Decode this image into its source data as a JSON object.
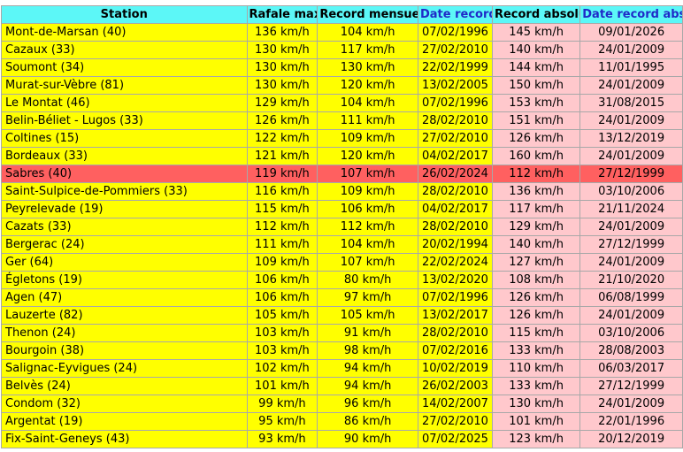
{
  "headers": {
    "station": "Station",
    "rafale_max": "Rafale max",
    "record_mensuel": "Record mensuel",
    "date_record": "Date record",
    "record_absolu": "Record absolu",
    "date_record_abs": "Date record abs."
  },
  "colors": {
    "header_bg": "#5cf7f7",
    "row_bg": "#ffff00",
    "absolute_bg": "#ffc8cc",
    "highlight_bg": "#ff6060",
    "header_date_text": "#1f29c8"
  },
  "highlighted_station": "Sabres (40)",
  "rows": [
    {
      "station": "Mont-de-Marsan (40)",
      "rafale": "136 km/h",
      "mensuel": "104 km/h",
      "date": "07/02/1996",
      "absolu": "145 km/h",
      "date_abs": "09/01/2026"
    },
    {
      "station": "Cazaux (33)",
      "rafale": "130 km/h",
      "mensuel": "117 km/h",
      "date": "27/02/2010",
      "absolu": "140 km/h",
      "date_abs": "24/01/2009"
    },
    {
      "station": "Soumont (34)",
      "rafale": "130 km/h",
      "mensuel": "130 km/h",
      "date": "22/02/1999",
      "absolu": "144 km/h",
      "date_abs": "11/01/1995"
    },
    {
      "station": "Murat-sur-Vèbre (81)",
      "rafale": "130 km/h",
      "mensuel": "120 km/h",
      "date": "13/02/2005",
      "absolu": "150 km/h",
      "date_abs": "24/01/2009"
    },
    {
      "station": "Le Montat (46)",
      "rafale": "129 km/h",
      "mensuel": "104 km/h",
      "date": "07/02/1996",
      "absolu": "153 km/h",
      "date_abs": "31/08/2015"
    },
    {
      "station": "Belin-Béliet - Lugos (33)",
      "rafale": "126 km/h",
      "mensuel": "111 km/h",
      "date": "28/02/2010",
      "absolu": "151 km/h",
      "date_abs": "24/01/2009"
    },
    {
      "station": "Coltines (15)",
      "rafale": "122 km/h",
      "mensuel": "109 km/h",
      "date": "27/02/2010",
      "absolu": "126 km/h",
      "date_abs": "13/12/2019"
    },
    {
      "station": "Bordeaux (33)",
      "rafale": "121 km/h",
      "mensuel": "120 km/h",
      "date": "04/02/2017",
      "absolu": "160 km/h",
      "date_abs": "24/01/2009"
    },
    {
      "station": "Sabres (40)",
      "rafale": "119 km/h",
      "mensuel": "107 km/h",
      "date": "26/02/2024",
      "absolu": "112 km/h",
      "date_abs": "27/12/1999"
    },
    {
      "station": "Saint-Sulpice-de-Pommiers (33)",
      "rafale": "116 km/h",
      "mensuel": "109 km/h",
      "date": "28/02/2010",
      "absolu": "136 km/h",
      "date_abs": "03/10/2006"
    },
    {
      "station": "Peyrelevade (19)",
      "rafale": "115 km/h",
      "mensuel": "106 km/h",
      "date": "04/02/2017",
      "absolu": "117 km/h",
      "date_abs": "21/11/2024"
    },
    {
      "station": "Cazats (33)",
      "rafale": "112 km/h",
      "mensuel": "112 km/h",
      "date": "28/02/2010",
      "absolu": "129 km/h",
      "date_abs": "24/01/2009"
    },
    {
      "station": "Bergerac (24)",
      "rafale": "111 km/h",
      "mensuel": "104 km/h",
      "date": "20/02/1994",
      "absolu": "140 km/h",
      "date_abs": "27/12/1999"
    },
    {
      "station": "Ger (64)",
      "rafale": "109 km/h",
      "mensuel": "107 km/h",
      "date": "22/02/2024",
      "absolu": "127 km/h",
      "date_abs": "24/01/2009"
    },
    {
      "station": "Égletons (19)",
      "rafale": "106 km/h",
      "mensuel": "80 km/h",
      "date": "13/02/2020",
      "absolu": "108 km/h",
      "date_abs": "21/10/2020"
    },
    {
      "station": "Agen (47)",
      "rafale": "106 km/h",
      "mensuel": "97 km/h",
      "date": "07/02/1996",
      "absolu": "126 km/h",
      "date_abs": "06/08/1999"
    },
    {
      "station": "Lauzerte (82)",
      "rafale": "105 km/h",
      "mensuel": "105 km/h",
      "date": "13/02/2017",
      "absolu": "126 km/h",
      "date_abs": "24/01/2009"
    },
    {
      "station": "Thenon (24)",
      "rafale": "103 km/h",
      "mensuel": "91 km/h",
      "date": "28/02/2010",
      "absolu": "115 km/h",
      "date_abs": "03/10/2006"
    },
    {
      "station": "Bourgoin (38)",
      "rafale": "103 km/h",
      "mensuel": "98 km/h",
      "date": "07/02/2016",
      "absolu": "133 km/h",
      "date_abs": "28/08/2003"
    },
    {
      "station": "Salignac-Eyvigues (24)",
      "rafale": "102 km/h",
      "mensuel": "94 km/h",
      "date": "10/02/2019",
      "absolu": "110 km/h",
      "date_abs": "06/03/2017"
    },
    {
      "station": "Belvès (24)",
      "rafale": "101 km/h",
      "mensuel": "94 km/h",
      "date": "26/02/2003",
      "absolu": "133 km/h",
      "date_abs": "27/12/1999"
    },
    {
      "station": "Condom (32)",
      "rafale": "99 km/h",
      "mensuel": "96 km/h",
      "date": "14/02/2007",
      "absolu": "130 km/h",
      "date_abs": "24/01/2009"
    },
    {
      "station": "Argentat (19)",
      "rafale": "95 km/h",
      "mensuel": "86 km/h",
      "date": "27/02/2010",
      "absolu": "101 km/h",
      "date_abs": "22/01/1996"
    },
    {
      "station": "Fix-Saint-Geneys (43)",
      "rafale": "93 km/h",
      "mensuel": "90 km/h",
      "date": "07/02/2025",
      "absolu": "123 km/h",
      "date_abs": "20/12/2019"
    }
  ]
}
